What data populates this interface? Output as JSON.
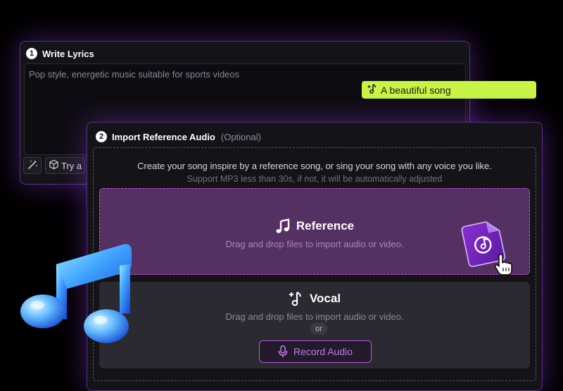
{
  "write_lyrics": {
    "step": "1",
    "title": "Write Lyrics",
    "placeholder": "Pop style, energetic music suitable for sports videos",
    "try_label": "Try a"
  },
  "suggestion_tag": {
    "label": "A beautiful song"
  },
  "reference_audio": {
    "step": "2",
    "title": "Import Reference Audio",
    "optional": "(Optional)",
    "desc": "Create your song inspire by a reference song, or sing your song with any voice you like.",
    "support": "Support MP3 less than 30s, if not, it will be automatically adjusted",
    "reference": {
      "title": "Reference",
      "sub": "Drag and drop files to import audio or video."
    },
    "vocal": {
      "title": "Vocal",
      "sub": "Drag and drop files to import audio or video.",
      "or": "or",
      "record_label": "Record Audio"
    }
  },
  "colors": {
    "accent_purple": "#d14ce8",
    "tag_green": "#c8f545",
    "panel_bg": "#141318"
  }
}
